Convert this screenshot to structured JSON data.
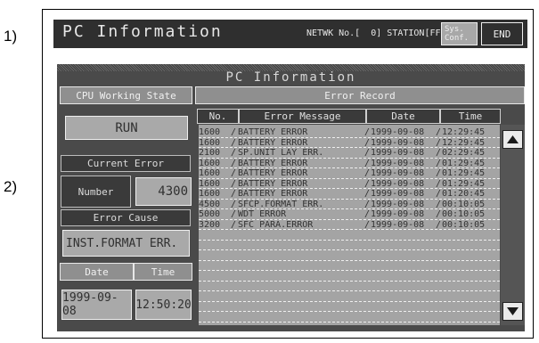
{
  "markers": {
    "m1": "1)",
    "m2": "2)"
  },
  "top_bar": {
    "title": "PC Information",
    "netwk_text": "NETWK No.[  0] STATION[FF]",
    "sys_conf_label": "Sys.\nConf.",
    "end_label": "END"
  },
  "panel": {
    "title": "PC Information",
    "cpu_state_label": "CPU Working State",
    "cpu_state_value": "RUN",
    "current_error_label": "Current Error",
    "number_label": "Number",
    "number_value": "4300",
    "error_cause_label": "Error Cause",
    "error_cause_value": "INST.FORMAT ERR.",
    "date_label": "Date",
    "time_label": "Time",
    "date_value": "1999-09-08",
    "time_value": "12:50:20"
  },
  "error_record": {
    "title": "Error Record",
    "columns": {
      "no": "No.",
      "message": "Error Message",
      "date": "Date",
      "time": "Time"
    },
    "rows": [
      {
        "no": "1600",
        "message": "BATTERY ERROR",
        "date": "1999-09-08",
        "time": "12:29:45"
      },
      {
        "no": "1600",
        "message": "BATTERY ERROR",
        "date": "1999-09-08",
        "time": "12:29:45"
      },
      {
        "no": "2100",
        "message": "SP.UNIT LAY ERR.",
        "date": "1999-09-08",
        "time": "02:29:45"
      },
      {
        "no": "1600",
        "message": "BATTERY ERROR",
        "date": "1999-09-08",
        "time": "01:29:45"
      },
      {
        "no": "1600",
        "message": "BATTERY ERROR",
        "date": "1999-09-08",
        "time": "01:29:45"
      },
      {
        "no": "1600",
        "message": "BATTERY ERROR",
        "date": "1999-09-08",
        "time": "01:29:45"
      },
      {
        "no": "1600",
        "message": "BATTERY ERROR",
        "date": "1999-09-08",
        "time": "01:20:45"
      },
      {
        "no": "4500",
        "message": "SFCP.FORMAT ERR.",
        "date": "1999-09-08",
        "time": "00:10:05"
      },
      {
        "no": "5000",
        "message": "WDT ERROR",
        "date": "1999-09-08",
        "time": "00:10:05"
      },
      {
        "no": "3200",
        "message": "SFC PARA.ERROR",
        "date": "1999-09-08",
        "time": "00:10:05"
      }
    ]
  },
  "icons": {
    "scroll_up": "triangle-up-icon",
    "scroll_down": "triangle-down-icon"
  }
}
